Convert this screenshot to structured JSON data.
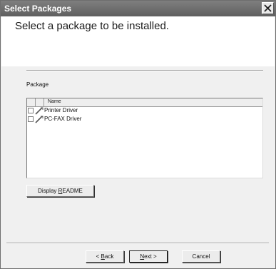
{
  "window": {
    "title": "Select Packages"
  },
  "header": {
    "heading": "Select a package to be installed."
  },
  "package_group": {
    "label": "Package",
    "columns": [
      "Name"
    ],
    "items": [
      {
        "label": "Printer Driver",
        "checked": false,
        "icon": "package-icon"
      },
      {
        "label": "PC-FAX Driver",
        "checked": false,
        "icon": "package-icon"
      }
    ]
  },
  "readme_button": {
    "pre": "Display ",
    "mnemonic": "R",
    "post": "EADME"
  },
  "footer": {
    "back": {
      "pre": "< ",
      "mnemonic": "B",
      "post": "ack"
    },
    "next": {
      "pre": "",
      "mnemonic": "N",
      "post": "ext >"
    },
    "cancel": "Cancel"
  },
  "icons": {
    "close": "close-icon",
    "package": "package-icon"
  }
}
